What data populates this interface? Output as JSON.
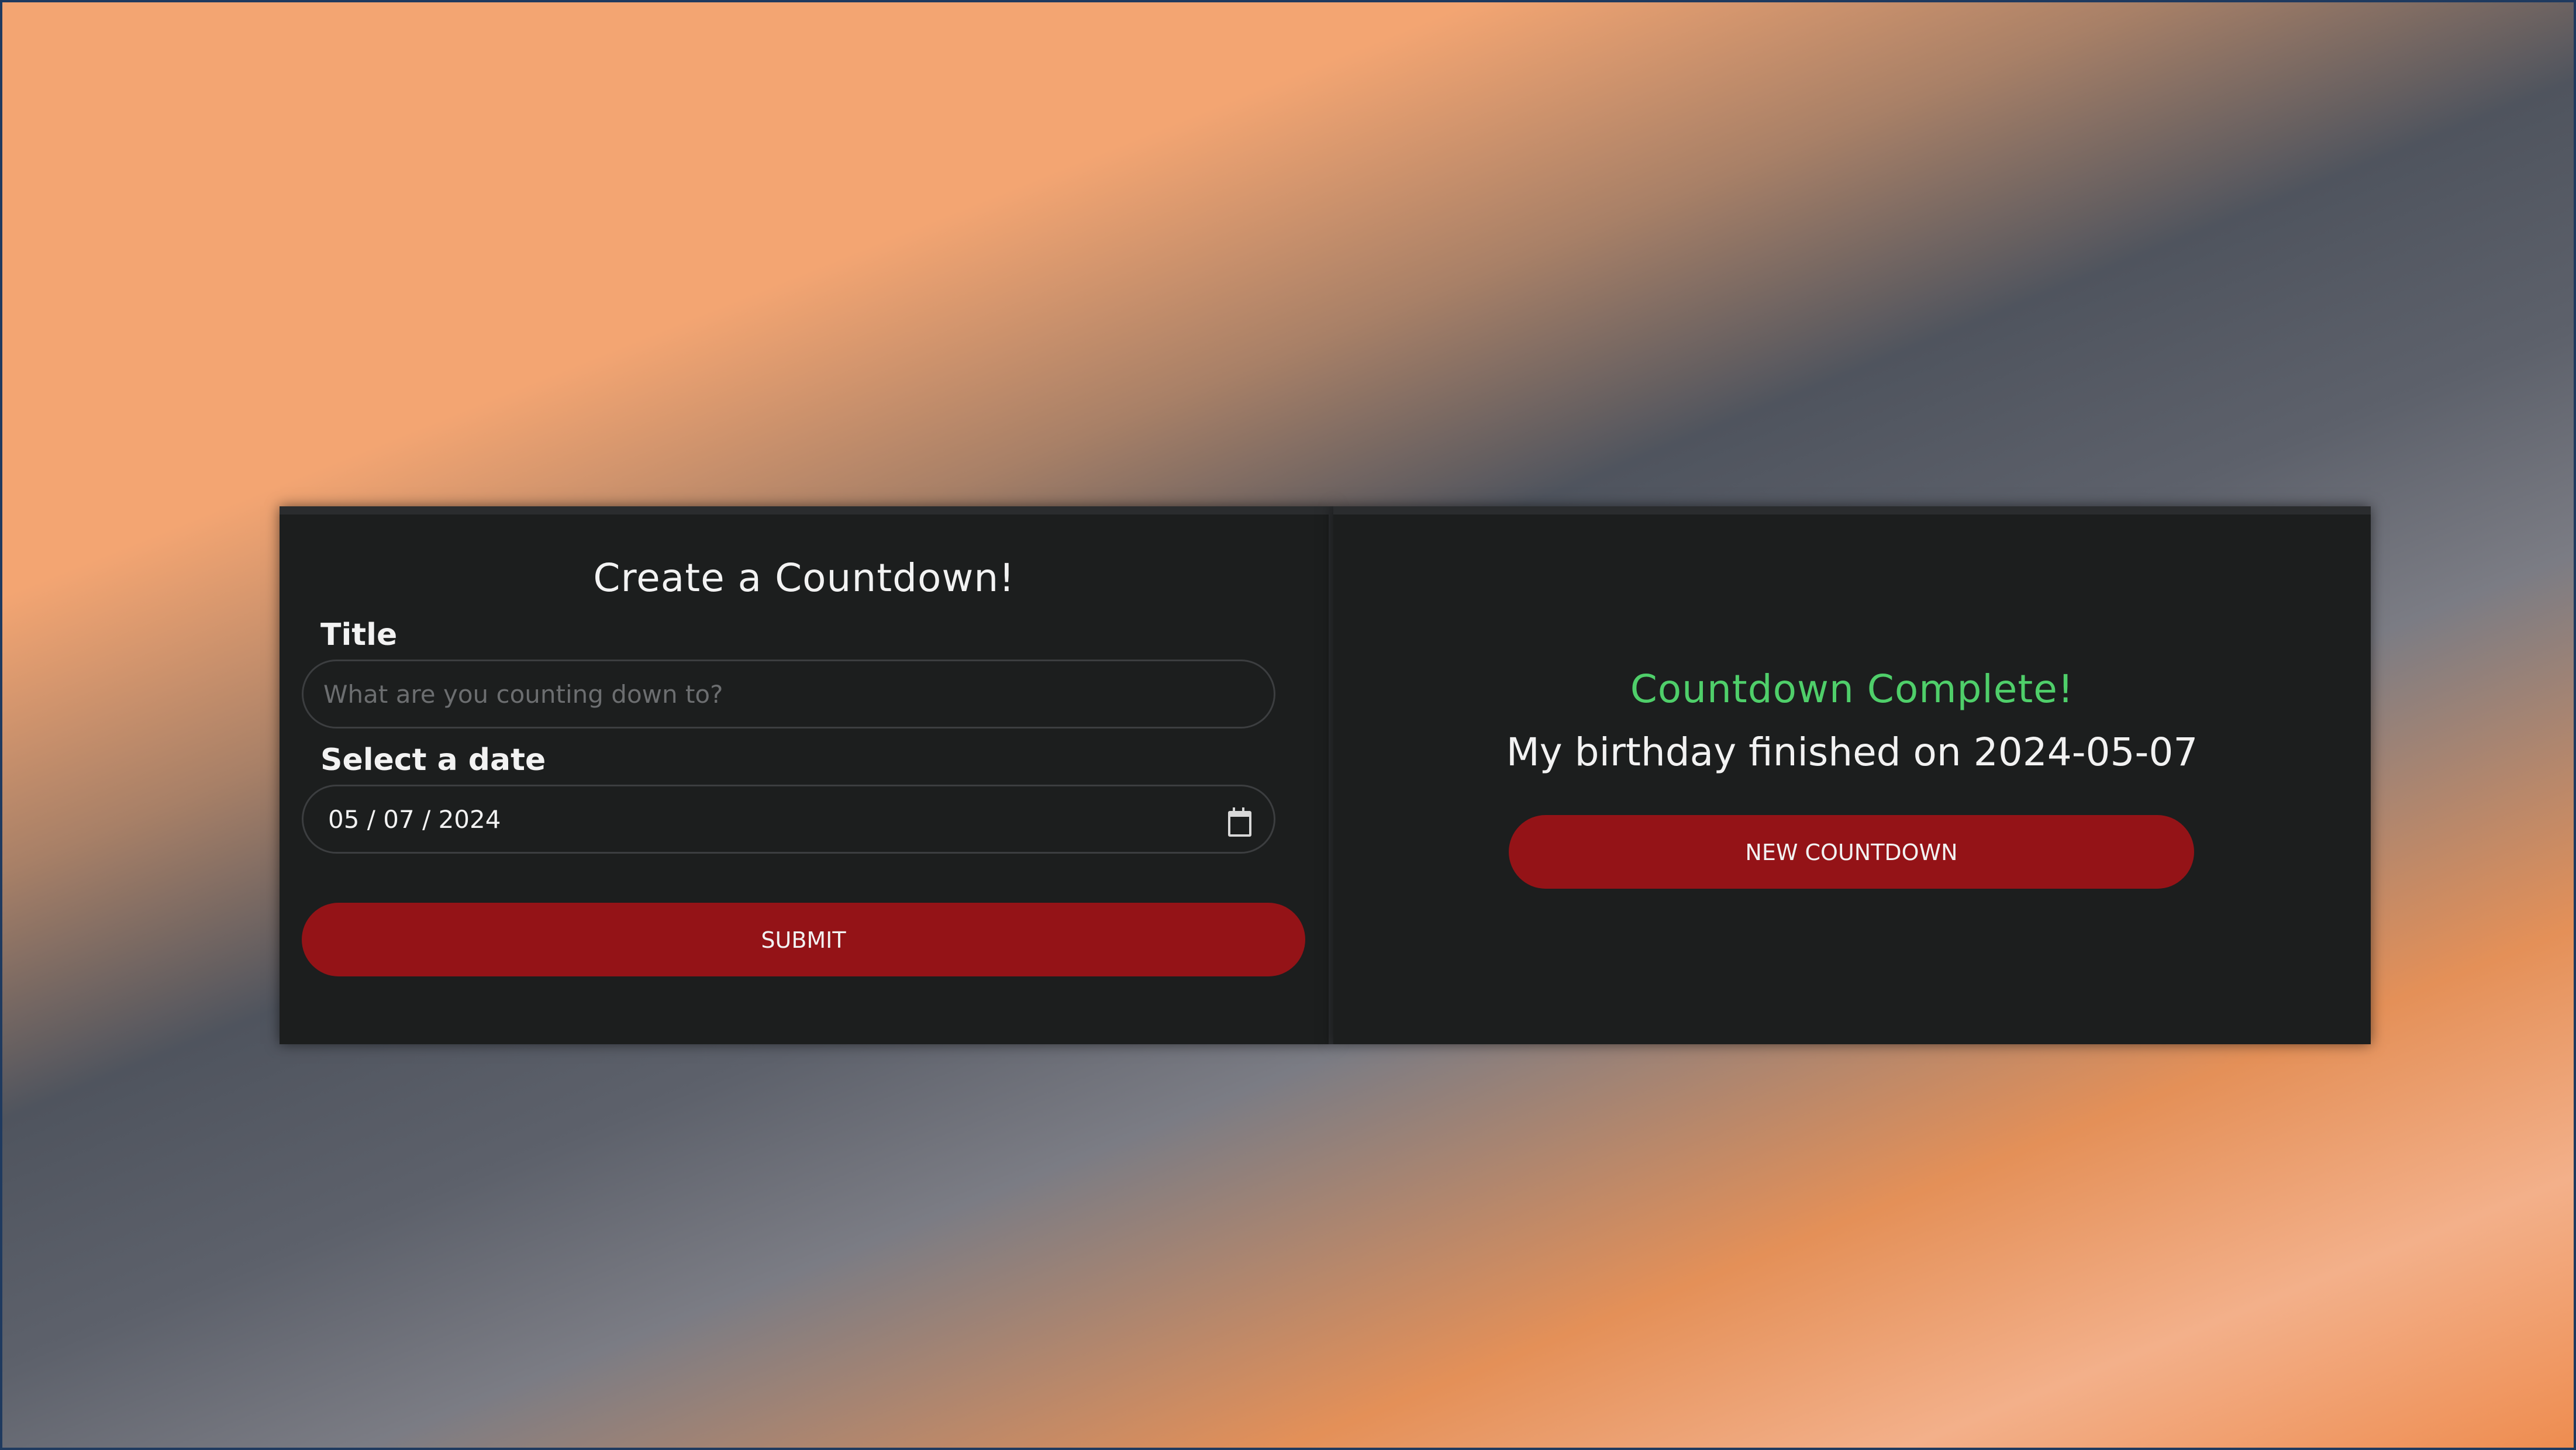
{
  "form": {
    "title": "Create a Countdown!",
    "title_label": "Title",
    "title_placeholder": "What are you counting down to?",
    "date_label": "Select a date",
    "date_value": "05 / 07 / 2024",
    "submit_label": "SUBMIT"
  },
  "result": {
    "status": "Countdown Complete!",
    "message": "My birthday finished on 2024-05-07",
    "new_label": "NEW COUNTDOWN"
  },
  "colors": {
    "accent_button": "#941317",
    "success_text": "#4fcf6a",
    "card_background": "#1c1e1e"
  },
  "icons": {
    "date_picker": "calendar-icon"
  }
}
